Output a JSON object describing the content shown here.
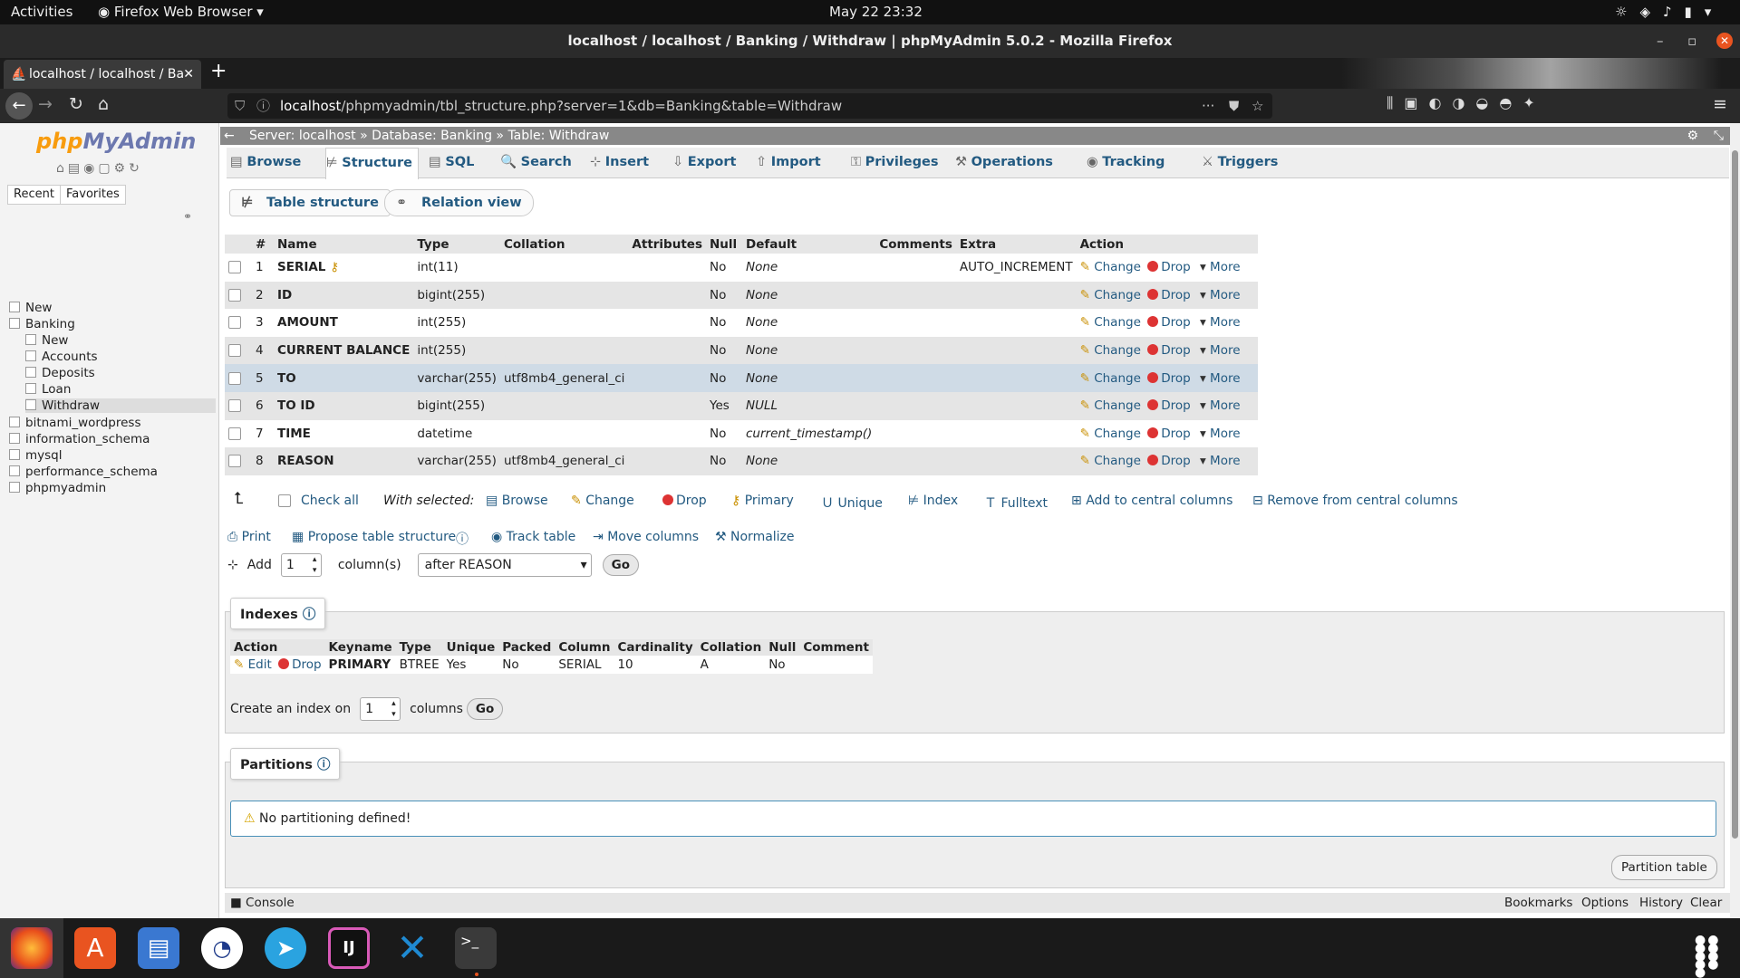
{
  "gnome": {
    "activities": "Activities",
    "app": "Firefox Web Browser",
    "clock": "May 22  23:32"
  },
  "window": {
    "title": "localhost / localhost / Banking / Withdraw | phpMyAdmin 5.0.2 - Mozilla Firefox"
  },
  "browser_tab": {
    "title": "localhost / localhost / Ba"
  },
  "url": {
    "host": "localhost",
    "path": "/phpmyadmin/tbl_structure.php?server=1&db=Banking&table=Withdraw"
  },
  "sidebar": {
    "logo_php": "php",
    "logo_myadmin": "MyAdmin",
    "recent": "Recent",
    "favorites": "Favorites",
    "tree": [
      {
        "label": "New",
        "level": 0
      },
      {
        "label": "Banking",
        "level": 0
      },
      {
        "label": "New",
        "level": 1
      },
      {
        "label": "Accounts",
        "level": 1
      },
      {
        "label": "Deposits",
        "level": 1
      },
      {
        "label": "Loan",
        "level": 1
      },
      {
        "label": "Withdraw",
        "level": 1
      },
      {
        "label": "bitnami_wordpress",
        "level": 0
      },
      {
        "label": "information_schema",
        "level": 0
      },
      {
        "label": "mysql",
        "level": 0
      },
      {
        "label": "performance_schema",
        "level": 0
      },
      {
        "label": "phpmyadmin",
        "level": 0
      }
    ]
  },
  "breadcrumb": {
    "server": "Server: localhost",
    "database": "Database: Banking",
    "table": "Table: Withdraw",
    "sep": "»"
  },
  "tabs": [
    "Browse",
    "Structure",
    "SQL",
    "Search",
    "Insert",
    "Export",
    "Import",
    "Privileges",
    "Operations",
    "Tracking",
    "Triggers"
  ],
  "subtabs": {
    "structure": "Table structure",
    "relation": "Relation view"
  },
  "structure": {
    "headers": [
      "#",
      "Name",
      "Type",
      "Collation",
      "Attributes",
      "Null",
      "Default",
      "Comments",
      "Extra",
      "Action"
    ],
    "rows": [
      {
        "n": "1",
        "name": "SERIAL",
        "type": "int(11)",
        "collation": "",
        "null": "No",
        "default": "None",
        "extra": "AUTO_INCREMENT"
      },
      {
        "n": "2",
        "name": "ID",
        "type": "bigint(255)",
        "collation": "",
        "null": "No",
        "default": "None",
        "extra": ""
      },
      {
        "n": "3",
        "name": "AMOUNT",
        "type": "int(255)",
        "collation": "",
        "null": "No",
        "default": "None",
        "extra": ""
      },
      {
        "n": "4",
        "name": "CURRENT BALANCE",
        "type": "int(255)",
        "collation": "",
        "null": "No",
        "default": "None",
        "extra": ""
      },
      {
        "n": "5",
        "name": "TO",
        "type": "varchar(255)",
        "collation": "utf8mb4_general_ci",
        "null": "No",
        "default": "None",
        "extra": ""
      },
      {
        "n": "6",
        "name": "TO ID",
        "type": "bigint(255)",
        "collation": "",
        "null": "Yes",
        "default": "NULL",
        "extra": ""
      },
      {
        "n": "7",
        "name": "TIME",
        "type": "datetime",
        "collation": "",
        "null": "No",
        "default": "current_timestamp()",
        "extra": ""
      },
      {
        "n": "8",
        "name": "REASON",
        "type": "varchar(255)",
        "collation": "utf8mb4_general_ci",
        "null": "No",
        "default": "None",
        "extra": ""
      }
    ],
    "actions": {
      "change": "Change",
      "drop": "Drop",
      "more": "More"
    }
  },
  "bulk": {
    "check_all": "Check all",
    "with_selected": "With selected:",
    "browse": "Browse",
    "change": "Change",
    "drop": "Drop",
    "primary": "Primary",
    "unique": "Unique",
    "index": "Index",
    "fulltext": "Fulltext",
    "add_central": "Add to central columns",
    "remove_central": "Remove from central columns"
  },
  "tools": {
    "print": "Print",
    "propose": "Propose table structure",
    "track": "Track table",
    "move": "Move columns",
    "normalize": "Normalize"
  },
  "addcol": {
    "add": "Add",
    "count": "1",
    "columns": "column(s)",
    "position": "after REASON",
    "go": "Go"
  },
  "indexes": {
    "legend": "Indexes",
    "headers": [
      "Action",
      "Keyname",
      "Type",
      "Unique",
      "Packed",
      "Column",
      "Cardinality",
      "Collation",
      "Null",
      "Comment"
    ],
    "row": {
      "edit": "Edit",
      "drop": "Drop",
      "keyname": "PRIMARY",
      "type": "BTREE",
      "unique": "Yes",
      "packed": "No",
      "column": "SERIAL",
      "cardinality": "10",
      "collation": "A",
      "null": "No",
      "comment": ""
    },
    "create_label": "Create an index on",
    "create_count": "1",
    "columns": "columns",
    "go": "Go"
  },
  "partitions": {
    "legend": "Partitions",
    "message": "No partitioning defined!",
    "button": "Partition table"
  },
  "console": {
    "label": "Console",
    "bookmarks": "Bookmarks",
    "options": "Options",
    "history": "History",
    "clear": "Clear"
  },
  "colors": {
    "link": "#235a81",
    "highlight_row": "#cfdbe6",
    "breadcrumb_bg": "#888888"
  }
}
